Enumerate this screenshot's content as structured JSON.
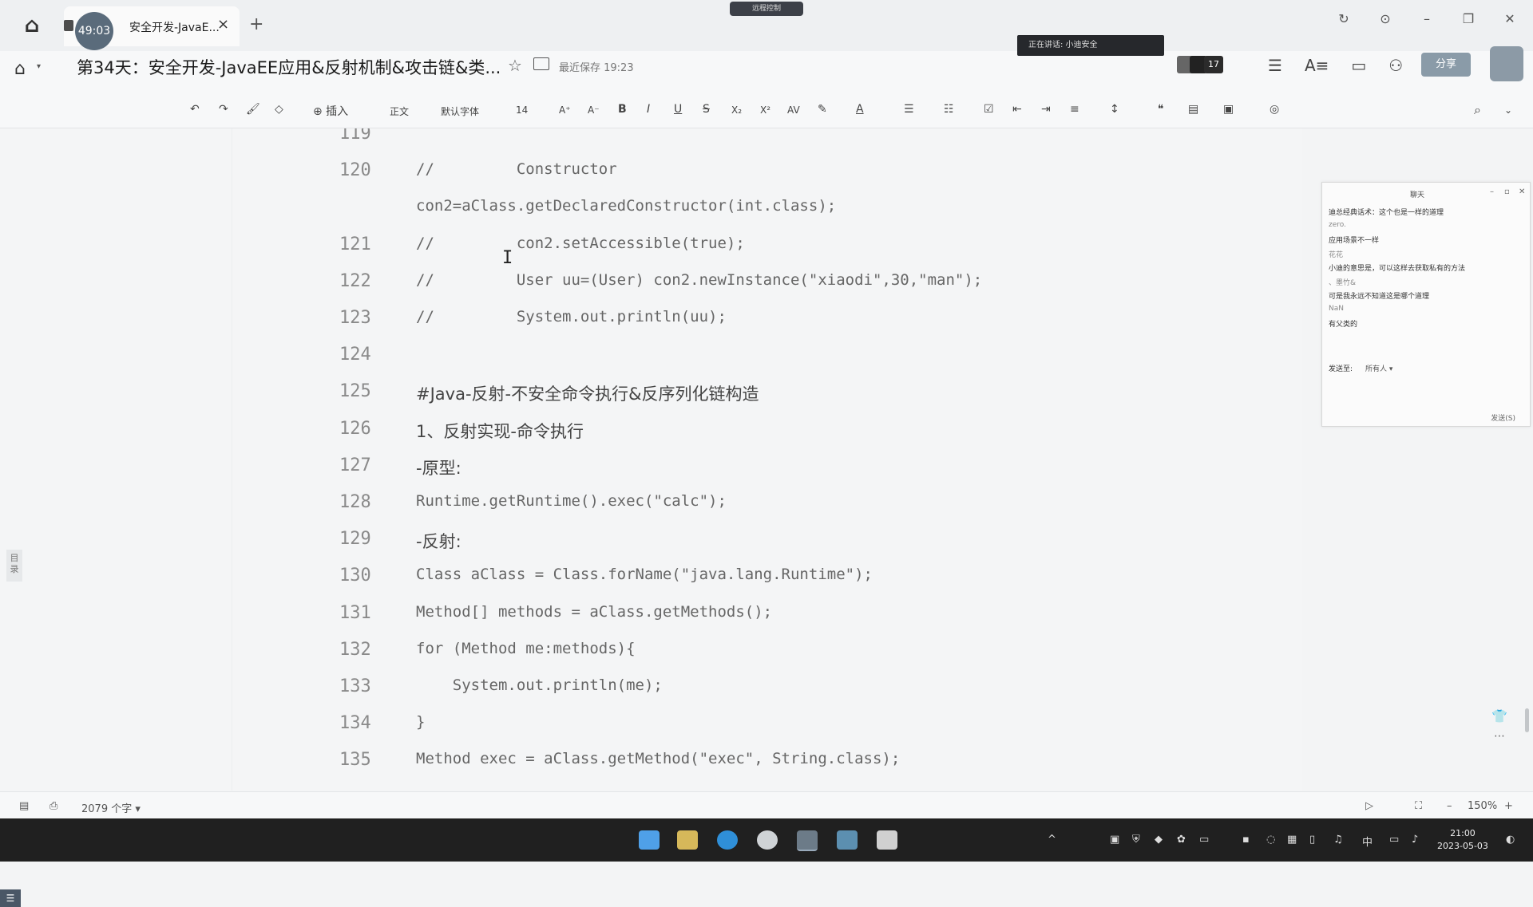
{
  "tabbar": {
    "timer": "49:03",
    "tab_title": "安全开发-JavaE...",
    "close_glyph": "×",
    "new_tab_glyph": "+",
    "top_pill": "远程控制",
    "window_controls": [
      "↻",
      "⊙",
      "–",
      "❐",
      "✕"
    ]
  },
  "header": {
    "doc_title": "第34天：安全开发-JavaEE应用&反射机制&攻击链&类...",
    "saved_status": "最近保存 19:23",
    "speaker": "正在讲话: 小迪安全",
    "collab_count": "17",
    "share_label": "分享",
    "icons": [
      "menu-icon",
      "font-size-icon",
      "present-icon",
      "user-icon"
    ]
  },
  "toolbar": {
    "insert": "⊕ 插入",
    "style": "正文",
    "font": "默认字体",
    "size": "14",
    "buttons": [
      "↶",
      "↷",
      "🖌",
      "◇",
      "A⁺",
      "A⁻",
      "B",
      "I",
      "U",
      "S",
      "X₂",
      "X²",
      "AV",
      "✎",
      "A",
      "☰",
      "☷",
      "☑",
      "⇤",
      "⇥",
      "≡",
      "↕",
      "❝",
      "▤",
      "▣",
      "◎"
    ]
  },
  "left_pane": {
    "toc_tag": "目录",
    "toc_button": "☰"
  },
  "editor": {
    "lines": [
      {
        "num": "119",
        "text": "",
        "cn": false
      },
      {
        "num": "120",
        "text": "//         Constructor",
        "cn": false
      },
      {
        "num": "",
        "text": "con2=aClass.getDeclaredConstructor(int.class);",
        "cn": false
      },
      {
        "num": "121",
        "text": "//         con2.setAccessible(true);",
        "cn": false
      },
      {
        "num": "122",
        "text": "//         User uu=(User) con2.newInstance(\"xiaodi\",30,\"man\");",
        "cn": false
      },
      {
        "num": "123",
        "text": "//         System.out.println(uu);",
        "cn": false
      },
      {
        "num": "124",
        "text": "",
        "cn": false
      },
      {
        "num": "125",
        "text": "#Java-反射-不安全命令执行&反序列化链构造",
        "cn": true
      },
      {
        "num": "126",
        "text": "1、反射实现-命令执行",
        "cn": true
      },
      {
        "num": "127",
        "text": "-原型:",
        "cn": true
      },
      {
        "num": "128",
        "text": "Runtime.getRuntime().exec(\"calc\");",
        "cn": false
      },
      {
        "num": "129",
        "text": "-反射:",
        "cn": true
      },
      {
        "num": "130",
        "text": "Class aClass = Class.forName(\"java.lang.Runtime\");",
        "cn": false
      },
      {
        "num": "131",
        "text": "Method[] methods = aClass.getMethods();",
        "cn": false
      },
      {
        "num": "132",
        "text": "for (Method me:methods){",
        "cn": false
      },
      {
        "num": "133",
        "text": "    System.out.println(me);",
        "cn": false
      },
      {
        "num": "134",
        "text": "}",
        "cn": false
      },
      {
        "num": "135",
        "text": "Method exec = aClass.getMethod(\"exec\", String.class);",
        "cn": false
      }
    ]
  },
  "chat": {
    "title": "聊天",
    "messages": [
      {
        "text": "迪总经典话术：这个也是一样的道理",
        "name": false
      },
      {
        "text": "zero.",
        "name": true
      },
      {
        "text": "应用场景不一样",
        "name": false
      },
      {
        "text": "花花",
        "name": true
      },
      {
        "text": "小迪的意思是，可以这样去获取私有的方法",
        "name": false
      },
      {
        "text": "、墨竹&",
        "name": true
      },
      {
        "text": "可是我永远不知道这是哪个道理",
        "name": false
      },
      {
        "text": "NaN",
        "name": true
      },
      {
        "text": "有父类的",
        "name": false
      }
    ],
    "send_to_label": "发送至:",
    "send_to_value": "所有人 ▾",
    "send_label": "发送(S)"
  },
  "statusbar": {
    "word_count": "2079 个字 ▾",
    "zoom": "150%",
    "zoom_out": "–",
    "zoom_in": "+"
  },
  "taskbar": {
    "tray_lang": "中",
    "time": "21:00",
    "date": "2023-05-03"
  }
}
